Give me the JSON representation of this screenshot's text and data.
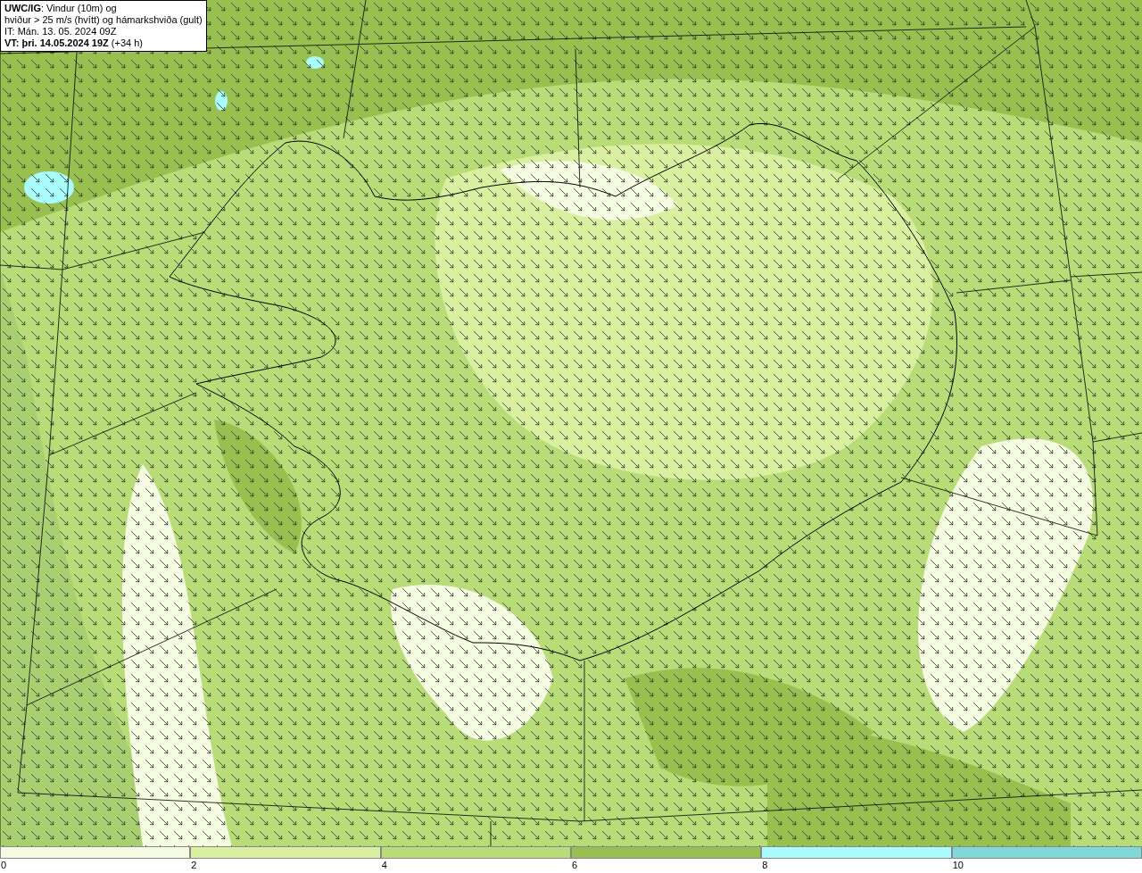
{
  "legend": {
    "lines": [
      "**UWC/IG**: Vindur (10m) og",
      "hviður > 25 m/s (hvítt) og hámarkshviða (gult)",
      "IT: Mán. 13. 05. 2024 09Z",
      "**VT: þri. 14.05.2024 19Z** (+34 h)"
    ]
  },
  "colorbar": {
    "segments": [
      {
        "label": "0",
        "color": "#f4fbe0"
      },
      {
        "label": "2",
        "color": "#d8f0a0"
      },
      {
        "label": "4",
        "color": "#b8dc78"
      },
      {
        "label": "6",
        "color": "#98c050"
      },
      {
        "label": "8",
        "color": "#a8fcfc"
      },
      {
        "label": "10",
        "color": "#80d8d8"
      }
    ]
  }
}
